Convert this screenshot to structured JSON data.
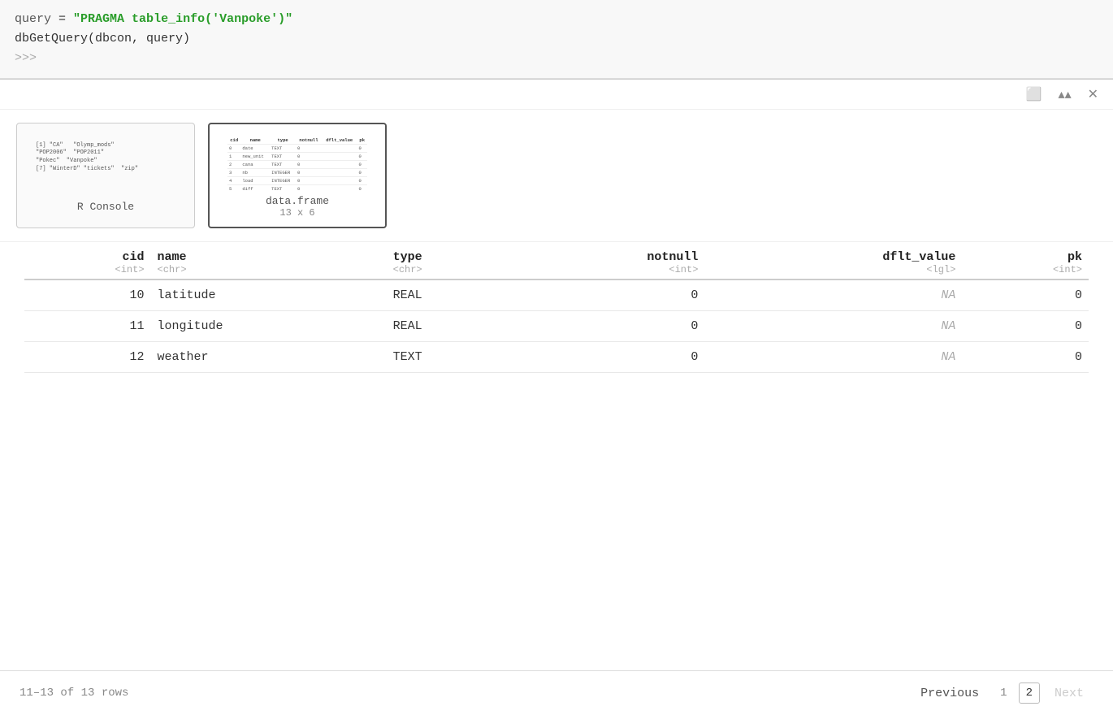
{
  "code": {
    "line1_prefix": "query = ",
    "line1_string": "\"PRAGMA table_info('Vanpoke')\"",
    "line2": "dbGetQuery(dbcon, query)",
    "line3": ">>>"
  },
  "toolbar": {
    "pop_out_icon": "⬡",
    "collapse_icon": "⌃⌃",
    "close_icon": "✕"
  },
  "thumbnails": [
    {
      "id": "r-console",
      "label": "R Console",
      "active": false,
      "preview_lines": [
        "[1] \"CA\"   \"Olymp_mods\" \"POP2006\"  \"POP2011\"",
        "\"Pokec\"  \"Vanpoke\"",
        "[7] \"WinterD\" \"tickets\"  \"zip\""
      ]
    },
    {
      "id": "data-frame",
      "label": "data.frame",
      "sublabel": "13 x 6",
      "active": true,
      "columns": [
        "cid",
        "name",
        "type",
        "notnull",
        "dflt_value",
        "pk"
      ],
      "rows": [
        [
          "0",
          "date",
          "TEXT",
          "0",
          "",
          "0"
        ],
        [
          "1",
          "new_unit",
          "TEXT",
          "0",
          "",
          "0"
        ],
        [
          "2",
          "cana",
          "TEXT",
          "0",
          "",
          "0"
        ],
        [
          "3",
          "nb",
          "INTEGER",
          "0",
          "",
          "0"
        ],
        [
          "4",
          "load",
          "INTEGER",
          "0",
          "",
          "0"
        ],
        [
          "5",
          "diff",
          "TEXT",
          "0",
          "",
          "0"
        ]
      ]
    }
  ],
  "table": {
    "columns": [
      {
        "key": "cid",
        "label": "cid",
        "subtype": "<int>",
        "align": "right"
      },
      {
        "key": "name",
        "label": "name",
        "subtype": "<chr>",
        "align": "left"
      },
      {
        "key": "type",
        "label": "type",
        "subtype": "<chr>",
        "align": "left"
      },
      {
        "key": "notnull",
        "label": "notnull",
        "subtype": "<int>",
        "align": "right"
      },
      {
        "key": "dflt_value",
        "label": "dflt_value",
        "subtype": "<lgl>",
        "align": "right"
      },
      {
        "key": "pk",
        "label": "pk",
        "subtype": "<int>",
        "align": "right"
      }
    ],
    "rows": [
      {
        "cid": "10",
        "name": "latitude",
        "type": "REAL",
        "notnull": "0",
        "dflt_value": "NA",
        "pk": "0"
      },
      {
        "cid": "11",
        "name": "longitude",
        "type": "REAL",
        "notnull": "0",
        "dflt_value": "NA",
        "pk": "0"
      },
      {
        "cid": "12",
        "name": "weather",
        "type": "TEXT",
        "notnull": "0",
        "dflt_value": "NA",
        "pk": "0"
      }
    ]
  },
  "pagination": {
    "row_count_label": "11–13 of 13 rows",
    "previous_label": "Previous",
    "next_label": "Next",
    "pages": [
      {
        "num": "1",
        "active": false
      },
      {
        "num": "2",
        "active": true
      }
    ]
  }
}
